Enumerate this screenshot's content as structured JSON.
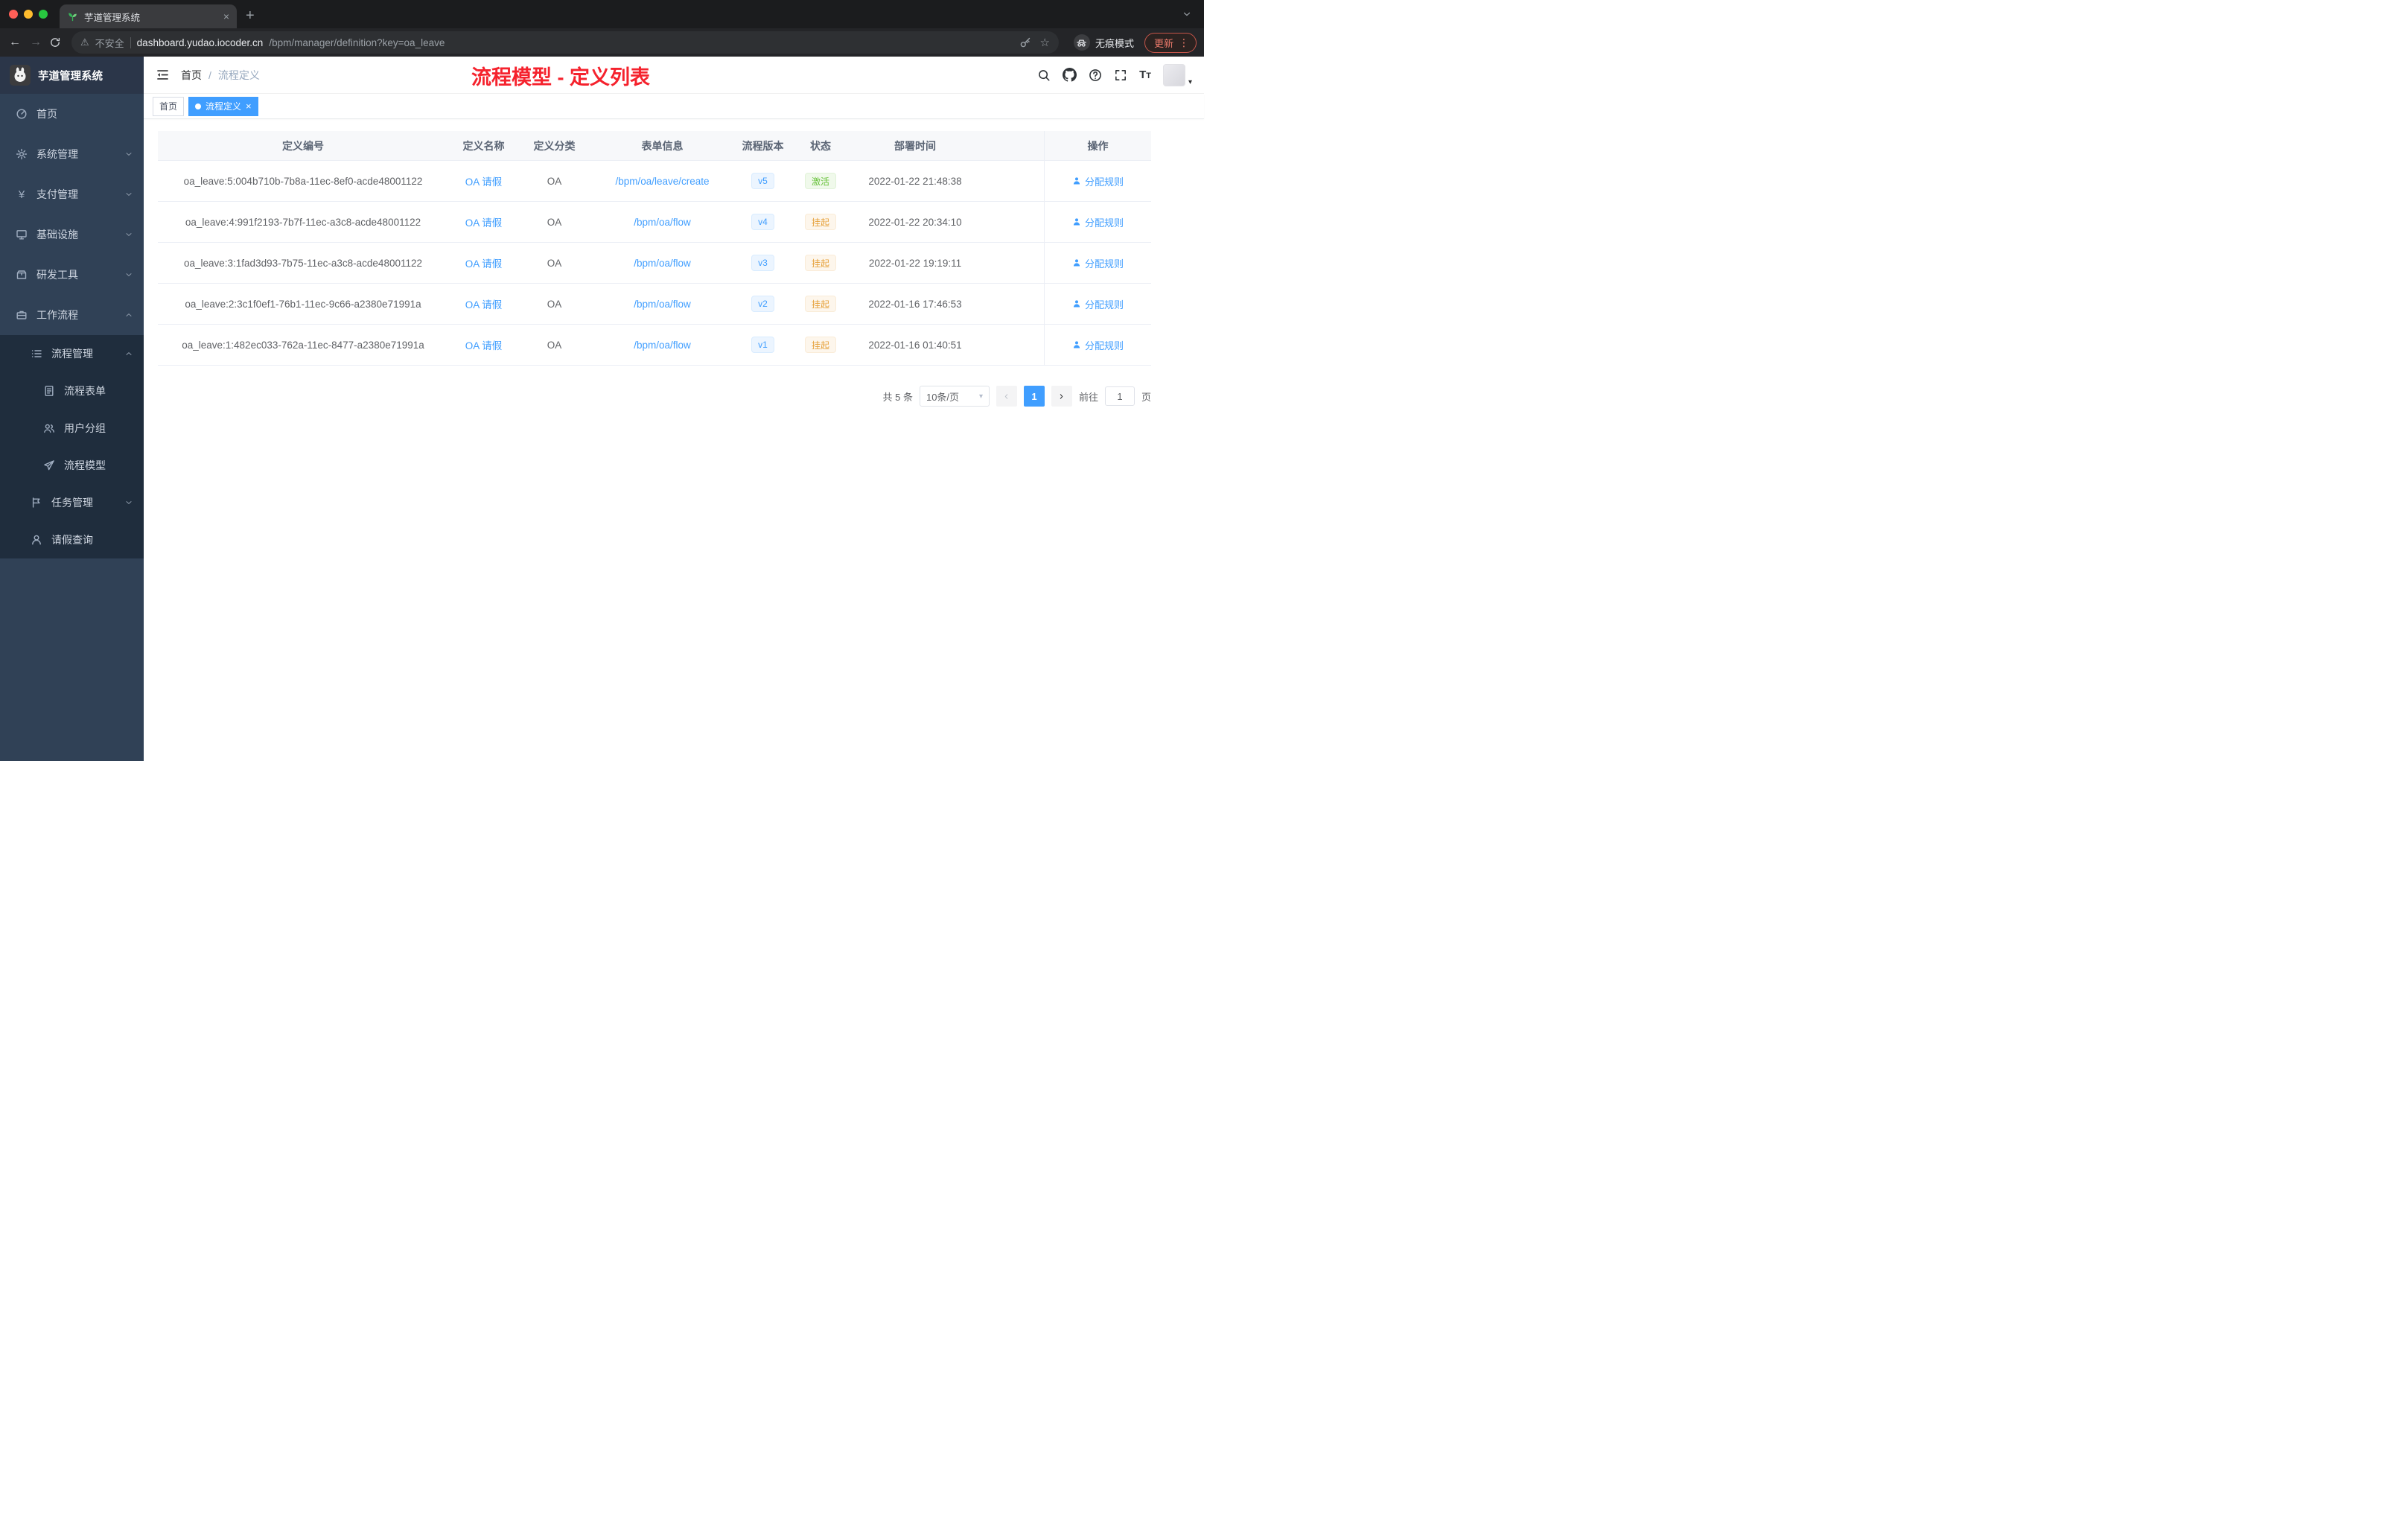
{
  "icons": {
    "back": "←",
    "forward": "→",
    "close": "×",
    "new_tab": "+",
    "more": "⋮",
    "star": "☆",
    "warning": "⚠",
    "caret_down": "▾",
    "yen": "¥",
    "font_large": "T",
    "font_small": "T",
    "crumb_sep": "/",
    "tag_close": "×"
  },
  "browser": {
    "tab_title": "芋道管理系统",
    "security_label": "不安全",
    "url_host": "dashboard.yudao.iocoder.cn",
    "url_path": "/bpm/manager/definition?key=oa_leave",
    "incognito_label": "无痕模式",
    "update_label": "更新"
  },
  "sidebar": {
    "logo_title": "芋道管理系统",
    "menu": [
      {
        "label": "首页"
      },
      {
        "label": "系统管理"
      },
      {
        "label": "支付管理"
      },
      {
        "label": "基础设施"
      },
      {
        "label": "研发工具"
      },
      {
        "label": "工作流程"
      }
    ],
    "submenu": {
      "process_mgmt": "流程管理",
      "process_form": "流程表单",
      "user_group": "用户分组",
      "process_model": "流程模型",
      "task_mgmt": "任务管理",
      "leave_query": "请假查询"
    }
  },
  "header": {
    "breadcrumb_home": "首页",
    "breadcrumb_current": "流程定义",
    "annotation": "流程模型 - 定义列表"
  },
  "tags": {
    "home": "首页",
    "active": "流程定义"
  },
  "table": {
    "headers": [
      "定义编号",
      "定义名称",
      "定义分类",
      "表单信息",
      "流程版本",
      "状态",
      "部署时间",
      "操作"
    ],
    "rows": [
      {
        "id": "oa_leave:5:004b710b-7b8a-11ec-8ef0-acde48001122",
        "name": "OA 请假",
        "category": "OA",
        "form": "/bpm/oa/leave/create",
        "version": "v5",
        "status": "激活",
        "status_type": "success",
        "deployed": "2022-01-22 21:48:38",
        "action": "分配规则"
      },
      {
        "id": "oa_leave:4:991f2193-7b7f-11ec-a3c8-acde48001122",
        "name": "OA 请假",
        "category": "OA",
        "form": "/bpm/oa/flow",
        "version": "v4",
        "status": "挂起",
        "status_type": "warning",
        "deployed": "2022-01-22 20:34:10",
        "action": "分配规则"
      },
      {
        "id": "oa_leave:3:1fad3d93-7b75-11ec-a3c8-acde48001122",
        "name": "OA 请假",
        "category": "OA",
        "form": "/bpm/oa/flow",
        "version": "v3",
        "status": "挂起",
        "status_type": "warning",
        "deployed": "2022-01-22 19:19:11",
        "action": "分配规则"
      },
      {
        "id": "oa_leave:2:3c1f0ef1-76b1-11ec-9c66-a2380e71991a",
        "name": "OA 请假",
        "category": "OA",
        "form": "/bpm/oa/flow",
        "version": "v2",
        "status": "挂起",
        "status_type": "warning",
        "deployed": "2022-01-16 17:46:53",
        "action": "分配规则"
      },
      {
        "id": "oa_leave:1:482ec033-762a-11ec-8477-a2380e71991a",
        "name": "OA 请假",
        "category": "OA",
        "form": "/bpm/oa/flow",
        "version": "v1",
        "status": "挂起",
        "status_type": "warning",
        "deployed": "2022-01-16 01:40:51",
        "action": "分配规则"
      }
    ]
  },
  "pagination": {
    "total": "共 5 条",
    "page_size": "10条/页",
    "page": "1",
    "goto": "前往",
    "unit": "页",
    "goto_value": "1"
  }
}
